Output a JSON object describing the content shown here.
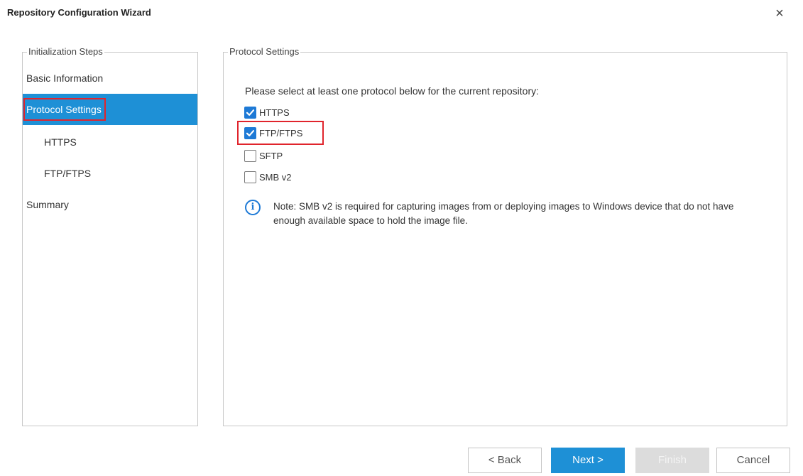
{
  "window": {
    "title": "Repository Configuration Wizard",
    "close_glyph": "×"
  },
  "steps": {
    "group_label": "Initialization Steps",
    "items": [
      {
        "label": "Basic Information",
        "selected": false,
        "level": 0
      },
      {
        "label": "Protocol Settings",
        "selected": true,
        "level": 0
      },
      {
        "label": "HTTPS",
        "selected": false,
        "level": 1
      },
      {
        "label": "FTP/FTPS",
        "selected": false,
        "level": 1
      },
      {
        "label": "Summary",
        "selected": false,
        "level": 0
      }
    ]
  },
  "protocol": {
    "group_label": "Protocol Settings",
    "prompt": "Please select at least one protocol below for the current repository:",
    "options": [
      {
        "label": "HTTPS",
        "checked": true
      },
      {
        "label": "FTP/FTPS",
        "checked": true
      },
      {
        "label": "SFTP",
        "checked": false
      },
      {
        "label": "SMB v2",
        "checked": false
      }
    ],
    "note_icon": "info-icon",
    "note": "Note:  SMB v2 is required for capturing images from or deploying images to Windows device that do not have enough available space to hold the image file."
  },
  "buttons": {
    "back": "< Back",
    "next": "Next >",
    "finish": "Finish",
    "cancel": "Cancel"
  },
  "colors": {
    "accent": "#1e90d6",
    "checkbox": "#1e7ad6",
    "highlight": "#e0242c"
  }
}
